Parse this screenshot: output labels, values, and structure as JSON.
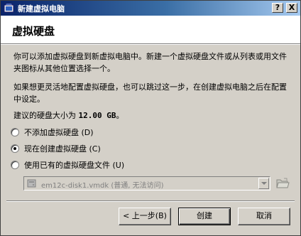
{
  "window": {
    "title": "新建虚拟电脑",
    "help_label": "?",
    "close_label": "X"
  },
  "header": {
    "heading": "虚拟硬盘"
  },
  "content": {
    "paragraph1": "你可以添加虚拟硬盘到新虚拟电脑中。新建一个虚拟硬盘文件或从列表或用文件夹图标从其他位置选择一个。",
    "paragraph2": "如果想更灵活地配置虚拟硬盘，也可以跳过这一步，在创建虚拟电脑之后在配置中设定。",
    "recommended_prefix": "建议的硬盘大小为 ",
    "recommended_size": "12.00 GB",
    "recommended_suffix": "。"
  },
  "options": [
    {
      "label": "不添加虚拟硬盘 (D)",
      "checked": false
    },
    {
      "label": "现在创建虚拟硬盘 (C)",
      "checked": true
    },
    {
      "label": "使用已有的虚拟硬盘文件 (U)",
      "checked": false
    }
  ],
  "disk_select": {
    "value": "em12c-disk1.vmdk (普通, 无法访问)",
    "icon": "hard-disk-icon",
    "enabled": false
  },
  "folder_button": {
    "icon": "folder-open-icon"
  },
  "buttons": {
    "back": "< 上一步(B)",
    "create": "创建",
    "cancel": "取消"
  },
  "colors": {
    "titlebar_start": "#0a246a",
    "titlebar_end": "#a6caf0",
    "face": "#d4d0c8"
  }
}
